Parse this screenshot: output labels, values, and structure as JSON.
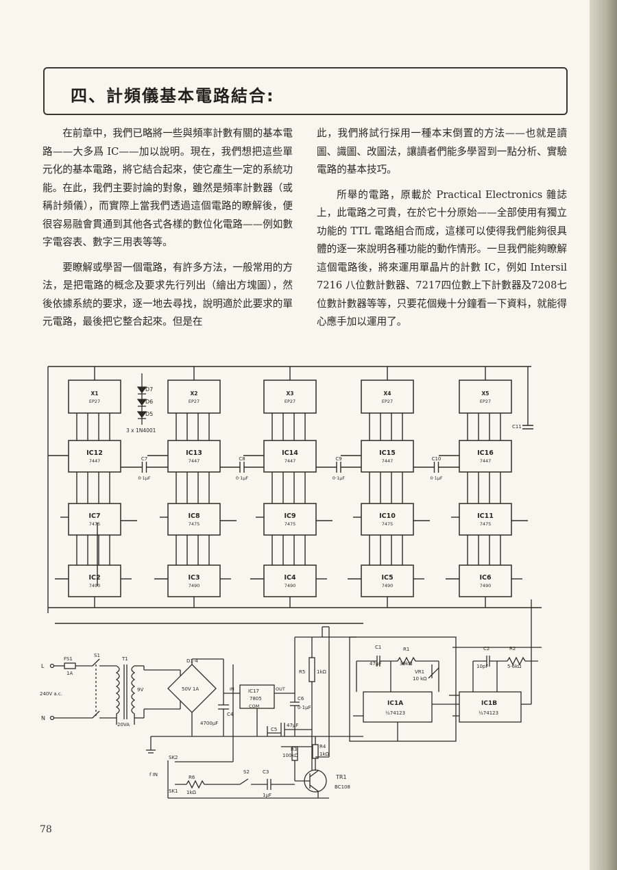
{
  "heading": "四、計頻儀基本電路結合:",
  "left_paragraphs": [
    "在前章中，我們已略將一些與頻率計數有關的基本電路——大多爲 IC——加以說明。現在，我們想把這些單元化的基本電路，將它結合起來，使它產生一定的系統功能。在此，我們主要討論的對象，雖然是頻率計數器（或稱計頻儀），而實際上當我們透過這個電路的瞭解後，便很容易融會貫通到其他各式各樣的數位化電路——例如數字電容表、數字三用表等等。",
    "要瞭解或學習一個電路，有許多方法，一般常用的方法，是把電路的概念及要求先行列出（繪出方塊圖），然後依據系統的要求，逐一地去尋找，說明適於此要求的單元電路，最後把它整合起來。但是在"
  ],
  "right_paragraphs": [
    "此，我們將試行採用一種本末倒置的方法——也就是讀圖、識圖、改圖法，讓讀者們能多學習到一點分析、實驗電路的基本技巧。",
    "所舉的電路，原載於 Practical Electronics 雜誌上，此電路之可貴，在於它十分原始——全部使用有獨立功能的 TTL 電路組合而成，這樣可以使得我們能夠很具體的逐一來說明各種功能的動作情形。一旦我們能夠瞭解這個電路後，將來運用單晶片的計數 IC，例如 Intersil 7216 八位數計數器、7217四位數上下計數器及7208七位數計數器等等，只要花個幾十分鐘看一下資料，就能得心應手加以運用了。"
  ],
  "schematic": {
    "displays": [
      {
        "ref": "X1",
        "type": "EP27"
      },
      {
        "ref": "X2",
        "type": "EP27"
      },
      {
        "ref": "X3",
        "type": "EP27"
      },
      {
        "ref": "X4",
        "type": "EP27"
      },
      {
        "ref": "X5",
        "type": "EP27"
      }
    ],
    "decoders": [
      {
        "ref": "IC12",
        "type": "7447"
      },
      {
        "ref": "IC13",
        "type": "7447"
      },
      {
        "ref": "IC14",
        "type": "7447"
      },
      {
        "ref": "IC15",
        "type": "7447"
      },
      {
        "ref": "IC16",
        "type": "7447"
      }
    ],
    "latches": [
      {
        "ref": "IC7",
        "type": "7475"
      },
      {
        "ref": "IC8",
        "type": "7475"
      },
      {
        "ref": "IC9",
        "type": "7475"
      },
      {
        "ref": "IC10",
        "type": "7475"
      },
      {
        "ref": "IC11",
        "type": "7475"
      }
    ],
    "counters": [
      {
        "ref": "IC2",
        "type": "7490"
      },
      {
        "ref": "IC3",
        "type": "7490"
      },
      {
        "ref": "IC4",
        "type": "7490"
      },
      {
        "ref": "IC5",
        "type": "7490"
      },
      {
        "ref": "IC6",
        "type": "7490"
      }
    ],
    "coupling_caps": [
      {
        "ref": "C7",
        "value": "0·1µF"
      },
      {
        "ref": "C8",
        "value": "0·1µF"
      },
      {
        "ref": "C9",
        "value": "0·1µF"
      },
      {
        "ref": "C10",
        "value": "0·1µF"
      }
    ],
    "diodes": {
      "refs": [
        "D7",
        "D6",
        "D5"
      ],
      "note": "3 x 1N4001"
    },
    "c11": "C11",
    "supply": {
      "live": "L",
      "neutral": "N",
      "fuse": "FS1",
      "fuse_rating": "1A",
      "switch": "S1",
      "mains": "240V a.c.",
      "transformer": "T1",
      "rating": "20VA",
      "secondary": "9V",
      "bridge": "D1-4",
      "bridge_rating": "50V 1A",
      "cap": "C4",
      "cap_value": "4700µF",
      "reg": "IC17",
      "reg_type": "7805",
      "reg_in": "IN",
      "reg_out": "OUT",
      "reg_com": "COM",
      "c6": "C6",
      "c6_value": "0·1µF"
    },
    "input": {
      "sk2": "SK2",
      "sk1": "SK1",
      "fin": "f IN",
      "r6": "R6",
      "r6_value": "1kΩ",
      "s2": "S2",
      "c3": "C3",
      "c3_value": "1µF",
      "r5": "R5",
      "r5_value": "1kΩ",
      "c5": "C5",
      "c5_value": "47µF",
      "r3": "R3",
      "r3_value": "100kΩ",
      "r4": "R4",
      "r4_value": "1kΩ",
      "tr": "TR1",
      "tr_type": "BC108"
    },
    "timer": {
      "c1": "C1",
      "c1_value": "47µF",
      "r1": "R1",
      "r1_value": "39kΩ",
      "vr1": "VR1",
      "vr1_value": "10 kΩ",
      "c2": "C2",
      "c2_value": "10pF",
      "r2": "R2",
      "r2_value": "5·6kΩ",
      "ic1a": "IC1A",
      "ic1b": "IC1B",
      "ic1_type": "½74123"
    }
  },
  "page_number": "78"
}
